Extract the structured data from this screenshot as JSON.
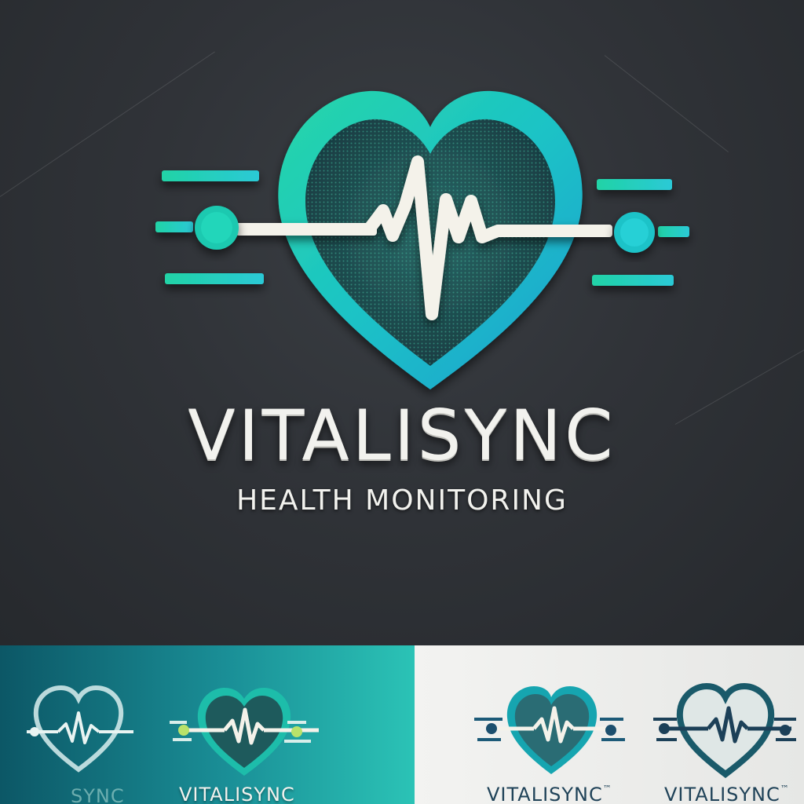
{
  "brand": {
    "name": "VITALISYNC",
    "tagline": "HEALTH MONITORING"
  },
  "variants": {
    "teal_cropped_name": "SYNC",
    "teal_name": "VITALISYNC",
    "light_name_1": "VITALISYNC",
    "light_name_1_mark": "™",
    "light_name_2": "VITALISYNC",
    "light_name_2_mark": "™"
  },
  "colors": {
    "background": "#2a2d31",
    "teal": "#1fc9b0",
    "cyan": "#22b8d8",
    "heart_fill": "#1f4d52",
    "pulse_line": "#f4f2ea",
    "text": "#f2f2ee",
    "navy": "#18405a"
  },
  "icons": {
    "main_logo": "heart-pulse-icon",
    "side_bars": "speed-lines-icon"
  }
}
